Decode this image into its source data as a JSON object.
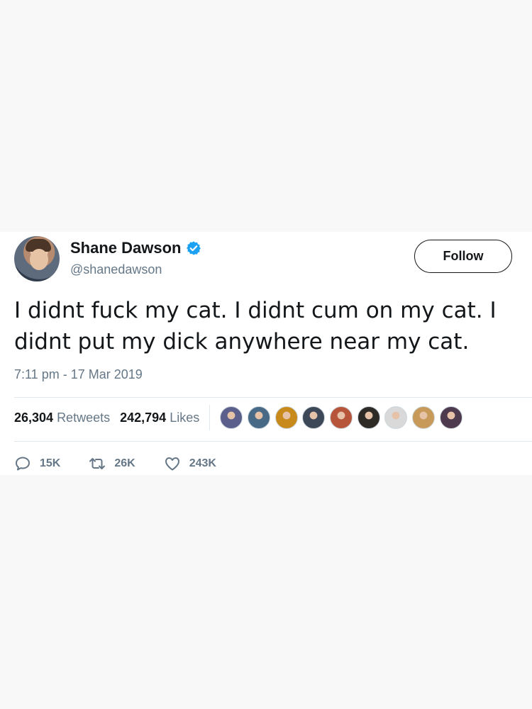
{
  "user": {
    "display_name": "Shane Dawson",
    "handle": "@shanedawson",
    "verified_icon": "verified-badge-icon",
    "verified_color": "#1da1f2"
  },
  "follow_label": "Follow",
  "tweet": {
    "text": "I didnt fuck my cat. I didnt cum on my cat. I didnt put my dick anywhere near my cat.",
    "timestamp": "7:11 pm - 17 Mar 2019"
  },
  "stats": {
    "retweets_count": "26,304",
    "retweets_label": "Retweets",
    "likes_count": "242,794",
    "likes_label": "Likes"
  },
  "likers": [
    {
      "color": "#5a5f8c"
    },
    {
      "color": "#486a86"
    },
    {
      "color": "#c98a1c"
    },
    {
      "color": "#3c4758"
    },
    {
      "color": "#b7553a"
    },
    {
      "color": "#2e2a26"
    },
    {
      "color": "#d9d9d9"
    },
    {
      "color": "#c89a5a"
    },
    {
      "color": "#4e3a4e"
    }
  ],
  "actions": {
    "reply": {
      "icon": "reply-icon",
      "count": "15K"
    },
    "retweet": {
      "icon": "retweet-icon",
      "count": "26K"
    },
    "like": {
      "icon": "heart-icon",
      "count": "243K"
    }
  },
  "colors": {
    "text_primary": "#14171a",
    "text_secondary": "#657786",
    "divider": "#e1e8ed",
    "background": "#f8f8f8"
  }
}
